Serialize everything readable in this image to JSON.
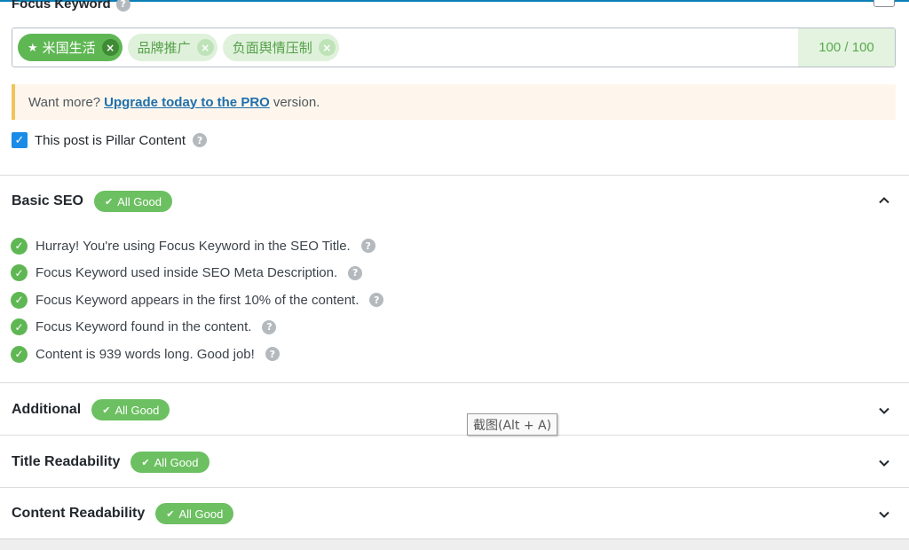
{
  "focus_keyword": {
    "label": "Focus Keyword",
    "tags": [
      {
        "text": "米国生活",
        "primary": true
      },
      {
        "text": "品牌推广",
        "primary": false
      },
      {
        "text": "负面舆情压制",
        "primary": false
      }
    ],
    "score": "100 / 100"
  },
  "upgrade_notice": {
    "prefix": "Want more?",
    "link": "Upgrade today to the PRO",
    "suffix": "version."
  },
  "pillar": {
    "label": "This post is Pillar Content",
    "checked": true
  },
  "sections": {
    "basic_seo": {
      "title": "Basic SEO",
      "badge": "All Good",
      "expanded": true
    },
    "additional": {
      "title": "Additional",
      "badge": "All Good",
      "expanded": false
    },
    "title_readability": {
      "title": "Title Readability",
      "badge": "All Good",
      "expanded": false
    },
    "content_readability": {
      "title": "Content Readability",
      "badge": "All Good",
      "expanded": false
    }
  },
  "basic_seo_tests": [
    "Hurray! You're using Focus Keyword in the SEO Title.",
    "Focus Keyword used inside SEO Meta Description.",
    "Focus Keyword appears in the first 10% of the content.",
    "Focus Keyword found in the content.",
    "Content is 939 words long. Good job!"
  ],
  "tooltip": "截图(Alt + A)",
  "icons": {
    "help": "question-mark-circle-icon",
    "check": "checkmark-circle-icon",
    "star": "star-icon",
    "remove": "close-icon",
    "collapse": "chevron-up-icon",
    "expand": "chevron-down-icon"
  },
  "colors": {
    "accent_blue": "#1a8ce8",
    "good_green": "#5fb754",
    "badge_green": "#6cc061",
    "notice_border": "#f0c45a",
    "link_blue": "#1e6fad"
  }
}
